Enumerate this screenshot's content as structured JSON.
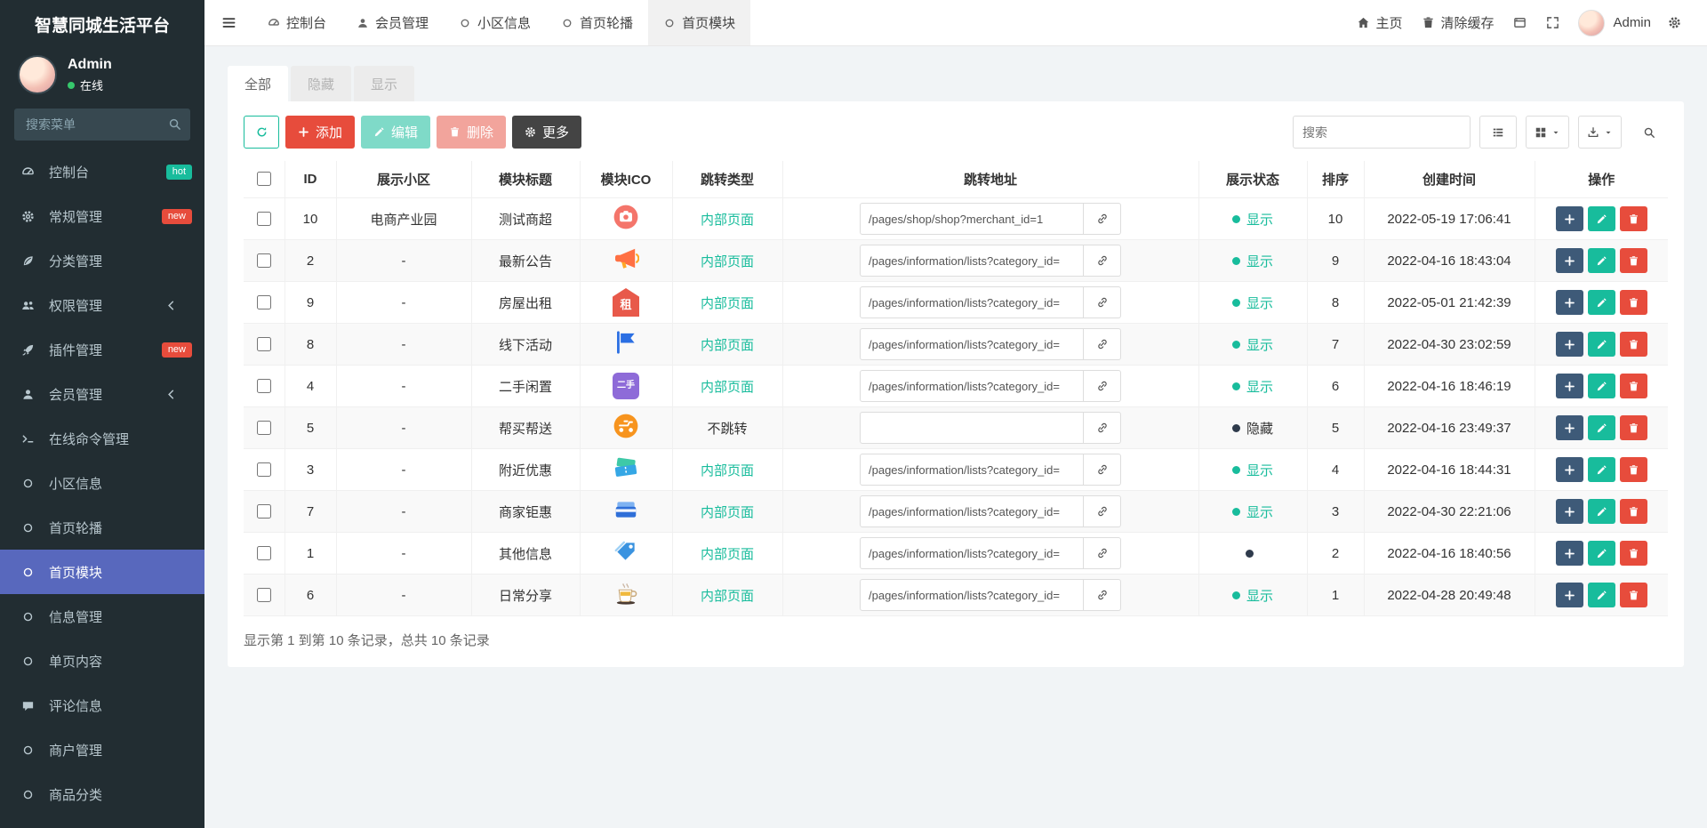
{
  "colors": {
    "accent": "#5868bd",
    "success": "#18bc9c",
    "danger": "#e74c3c",
    "dark": "#3e5a78",
    "sidebar": "#222d32"
  },
  "app": {
    "title": "智慧同城生活平台"
  },
  "user": {
    "name": "Admin",
    "status_label": "在线"
  },
  "sidebar": {
    "search_placeholder": "搜索菜单",
    "items": [
      {
        "key": "dashboard",
        "label": "控制台",
        "icon": "dashboard-icon",
        "badge": {
          "text": "hot",
          "color": "#18bc9c"
        }
      },
      {
        "key": "general",
        "label": "常规管理",
        "icon": "gear-icon",
        "badge": {
          "text": "new",
          "color": "#e74c3c"
        }
      },
      {
        "key": "category",
        "label": "分类管理",
        "icon": "leaf-icon"
      },
      {
        "key": "auth",
        "label": "权限管理",
        "icon": "users-icon",
        "chevron": true
      },
      {
        "key": "addon",
        "label": "插件管理",
        "icon": "rocket-icon",
        "badge": {
          "text": "new",
          "color": "#e74c3c"
        }
      },
      {
        "key": "member",
        "label": "会员管理",
        "icon": "user-icon",
        "chevron": true
      },
      {
        "key": "online-command",
        "label": "在线命令管理",
        "icon": "terminal-icon"
      },
      {
        "key": "community-info",
        "label": "小区信息",
        "icon": "circle-icon"
      },
      {
        "key": "home-banner",
        "label": "首页轮播",
        "icon": "circle-icon"
      },
      {
        "key": "home-module",
        "label": "首页模块",
        "icon": "circle-icon",
        "active": true
      },
      {
        "key": "info-manage",
        "label": "信息管理",
        "icon": "circle-icon"
      },
      {
        "key": "single-page",
        "label": "单页内容",
        "icon": "circle-icon"
      },
      {
        "key": "comment-info",
        "label": "评论信息",
        "icon": "comment-icon"
      },
      {
        "key": "merchant",
        "label": "商户管理",
        "icon": "circle-icon"
      },
      {
        "key": "goods-category",
        "label": "商品分类",
        "icon": "circle-icon"
      }
    ]
  },
  "navbar": {
    "tabs": [
      {
        "key": "dashboard",
        "label": "控制台",
        "icon": "dashboard-icon"
      },
      {
        "key": "member",
        "label": "会员管理",
        "icon": "user-icon"
      },
      {
        "key": "community-info",
        "label": "小区信息",
        "icon": "circle-icon"
      },
      {
        "key": "home-banner",
        "label": "首页轮播",
        "icon": "circle-icon"
      },
      {
        "key": "home-module",
        "label": "首页模块",
        "icon": "circle-icon",
        "active": true
      }
    ],
    "home_label": "主页",
    "clear_cache_label": "清除缓存",
    "username": "Admin"
  },
  "filter_tabs": [
    {
      "key": "all",
      "label": "全部",
      "active": true
    },
    {
      "key": "hidden",
      "label": "隐藏"
    },
    {
      "key": "visible",
      "label": "显示"
    }
  ],
  "toolbar": {
    "add_label": "添加",
    "edit_label": "编辑",
    "delete_label": "删除",
    "more_label": "更多",
    "search_placeholder": "搜索"
  },
  "table": {
    "columns": [
      "ID",
      "展示小区",
      "模块标题",
      "模块ICO",
      "跳转类型",
      "跳转地址",
      "展示状态",
      "排序",
      "创建时间",
      "操作"
    ],
    "rows": [
      {
        "id": "10",
        "community": "电商产业园",
        "title": "测试商超",
        "icon": {
          "name": "store-logo-icon"
        },
        "jump_type": "内部页面",
        "jump_link": true,
        "url": "/pages/shop/shop?merchant_id=1",
        "status": "show",
        "status_label": "显示",
        "sort": "10",
        "created": "2022-05-19 17:06:41"
      },
      {
        "id": "2",
        "community": "-",
        "title": "最新公告",
        "icon": {
          "name": "megaphone-icon"
        },
        "jump_type": "内部页面",
        "jump_link": true,
        "url": "/pages/information/lists?category_id=",
        "status": "show",
        "status_label": "显示",
        "sort": "9",
        "created": "2022-04-16 18:43:04"
      },
      {
        "id": "9",
        "community": "-",
        "title": "房屋出租",
        "icon": {
          "name": "house-rent-icon",
          "text": "租",
          "bg": "#e8594a"
        },
        "jump_type": "内部页面",
        "jump_link": true,
        "url": "/pages/information/lists?category_id=",
        "status": "show",
        "status_label": "显示",
        "sort": "8",
        "created": "2022-05-01 21:42:39"
      },
      {
        "id": "8",
        "community": "-",
        "title": "线下活动",
        "icon": {
          "name": "flag-icon"
        },
        "jump_type": "内部页面",
        "jump_link": true,
        "url": "/pages/information/lists?category_id=",
        "status": "show",
        "status_label": "显示",
        "sort": "7",
        "created": "2022-04-30 23:02:59"
      },
      {
        "id": "4",
        "community": "-",
        "title": "二手闲置",
        "icon": {
          "name": "secondhand-icon",
          "text": "二手",
          "bg": "#8e6bd8",
          "small": true
        },
        "jump_type": "内部页面",
        "jump_link": true,
        "url": "/pages/information/lists?category_id=",
        "status": "show",
        "status_label": "显示",
        "sort": "6",
        "created": "2022-04-16 18:46:19"
      },
      {
        "id": "5",
        "community": "-",
        "title": "帮买帮送",
        "icon": {
          "name": "delivery-icon"
        },
        "jump_type": "不跳转",
        "jump_link": false,
        "url": "",
        "status": "hide",
        "status_label": "隐藏",
        "sort": "5",
        "created": "2022-04-16 23:49:37"
      },
      {
        "id": "3",
        "community": "-",
        "title": "附近优惠",
        "icon": {
          "name": "coupon-icon"
        },
        "jump_type": "内部页面",
        "jump_link": true,
        "url": "/pages/information/lists?category_id=",
        "status": "show",
        "status_label": "显示",
        "sort": "4",
        "created": "2022-04-16 18:44:31"
      },
      {
        "id": "7",
        "community": "-",
        "title": "商家钜惠",
        "icon": {
          "name": "cards-icon"
        },
        "jump_type": "内部页面",
        "jump_link": true,
        "url": "/pages/information/lists?category_id=",
        "status": "show",
        "status_label": "显示",
        "sort": "3",
        "created": "2022-04-30 22:21:06"
      },
      {
        "id": "1",
        "community": "-",
        "title": "其他信息",
        "icon": {
          "name": "tag-icon"
        },
        "jump_type": "内部页面",
        "jump_link": true,
        "url": "/pages/information/lists?category_id=",
        "status": "dot",
        "status_label": "",
        "sort": "2",
        "created": "2022-04-16 18:40:56"
      },
      {
        "id": "6",
        "community": "-",
        "title": "日常分享",
        "icon": {
          "name": "coffee-icon"
        },
        "jump_type": "内部页面",
        "jump_link": true,
        "url": "/pages/information/lists?category_id=",
        "status": "show",
        "status_label": "显示",
        "sort": "1",
        "created": "2022-04-28 20:49:48"
      }
    ]
  },
  "footer": {
    "summary": "显示第 1 到第 10 条记录，总共 10 条记录"
  }
}
